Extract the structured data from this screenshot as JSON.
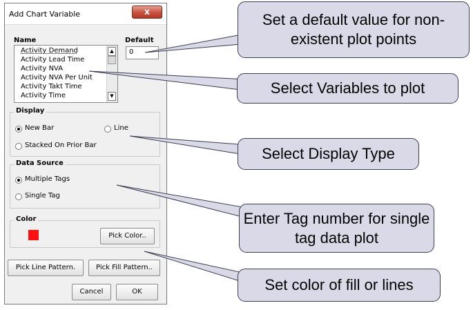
{
  "dialog": {
    "title": "Add Chart Variable",
    "close_glyph": "x",
    "name_header": "Name",
    "default_header": "Default",
    "default_value": "0",
    "variables": [
      "Activity Demand",
      "Activity Lead Time",
      "Activity NVA",
      "Activity NVA Per Unit",
      "Activity Takt Time",
      "Activity Time"
    ],
    "display": {
      "legend": "Display",
      "new_bar": "New Bar",
      "line": "Line",
      "stacked": "Stacked On Prior Bar",
      "selected": "New Bar"
    },
    "data_source": {
      "legend": "Data Source",
      "multiple": "Multiple Tags",
      "single": "Single Tag",
      "selected": "Multiple Tags"
    },
    "color": {
      "legend": "Color",
      "swatch": "#ff1010",
      "pick_label": "Pick Color.."
    },
    "buttons": {
      "line_pattern": "Pick Line Pattern.",
      "fill_pattern": "Pick Fill Pattern..",
      "cancel": "Cancel",
      "ok": "OK"
    },
    "scroll_up_glyph": "▲",
    "scroll_down_glyph": "▼"
  },
  "callouts": {
    "default_value": "Set a default value for non-existent plot points",
    "variables": "Select Variables to plot",
    "display_type": "Select Display Type",
    "tag_number": "Enter Tag number for single tag data plot",
    "color": "Set color of fill or lines"
  },
  "colors": {
    "callout_fill": "#d9d9e8",
    "close_button": "#c8503c"
  }
}
